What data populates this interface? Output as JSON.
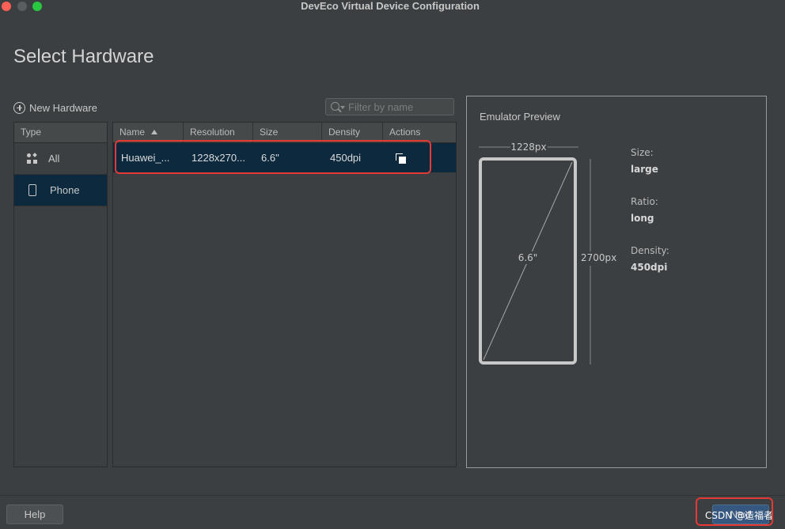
{
  "window": {
    "title": "DevEco Virtual Device Configuration"
  },
  "page": {
    "title": "Select Hardware"
  },
  "toolbar": {
    "new_hardware_label": "New Hardware",
    "filter_placeholder": "Filter by name"
  },
  "type_panel": {
    "header": "Type",
    "items": [
      {
        "label": "All",
        "icon": "category-grid-icon",
        "selected": false
      },
      {
        "label": "Phone",
        "icon": "phone-icon",
        "selected": true
      }
    ]
  },
  "table": {
    "columns": [
      "Name",
      "Resolution",
      "Size",
      "Density",
      "Actions"
    ],
    "sort_column": "Name",
    "rows": [
      {
        "name": "Huawei_...",
        "resolution": "1228x270...",
        "size": "6.6\"",
        "density": "450dpi",
        "action_icon": "clone-icon",
        "selected": true
      }
    ]
  },
  "preview": {
    "title": "Emulator Preview",
    "width_label": "1228px",
    "height_label": "2700px",
    "diagonal_label": "6.6\"",
    "specs": [
      {
        "label": "Size:",
        "value": "large"
      },
      {
        "label": "Ratio:",
        "value": "long"
      },
      {
        "label": "Density:",
        "value": "450dpi"
      }
    ]
  },
  "footer": {
    "help_label": "Help",
    "next_label": "Next"
  },
  "watermark": "CSDN @造福者",
  "colors": {
    "background": "#3c3f41",
    "selection": "#0d293e",
    "primary_button": "#365880",
    "highlight_box": "#e53935"
  }
}
